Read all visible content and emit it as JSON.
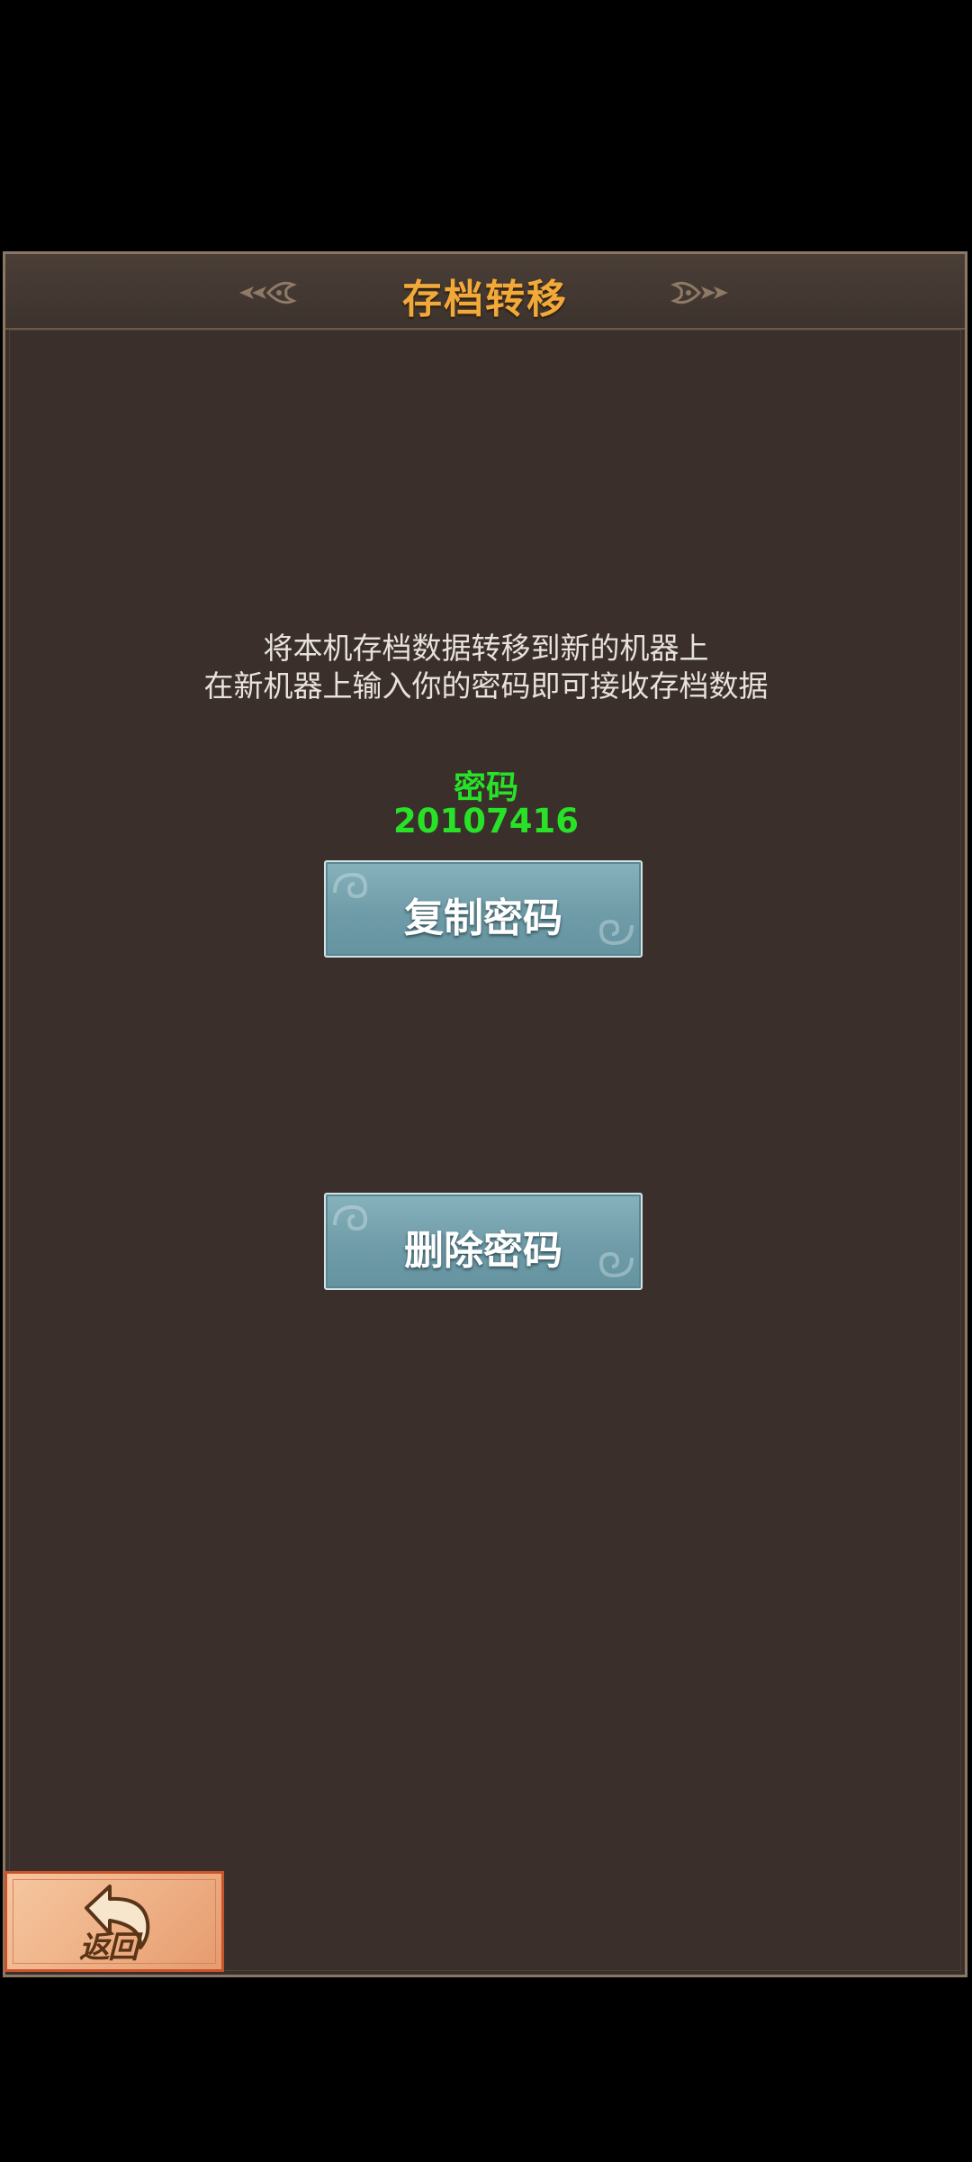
{
  "dialog": {
    "title": "存档转移"
  },
  "info": {
    "line1": "将本机存档数据转移到新的机器上",
    "line2": "在新机器上输入你的密码即可接收存档数据"
  },
  "password": {
    "label": "密码",
    "value": "20107416"
  },
  "buttons": {
    "copy_label": "复制密码",
    "delete_label": "删除密码",
    "back_label": "返回"
  },
  "colors": {
    "panel_bg": "#3a2f2a",
    "title_color": "#f2a93a",
    "password_color": "#28e228",
    "button_bg": "#6f9ca8",
    "back_button_bg": "#f0b48a"
  },
  "icons": {
    "title_left": "ornament-left-icon",
    "title_right": "ornament-right-icon",
    "back": "back-arrow-icon"
  }
}
